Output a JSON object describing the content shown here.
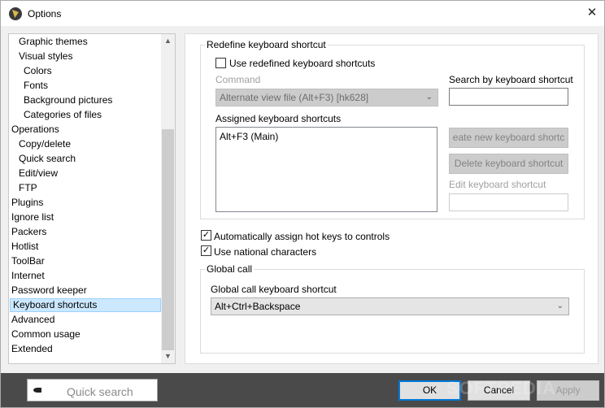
{
  "window": {
    "title": "Options",
    "close_glyph": "✕"
  },
  "tree": {
    "items": [
      {
        "label": "Graphic themes",
        "level": 1
      },
      {
        "label": "Visual styles",
        "level": 1
      },
      {
        "label": "Colors",
        "level": 2
      },
      {
        "label": "Fonts",
        "level": 2
      },
      {
        "label": "Background pictures",
        "level": 2
      },
      {
        "label": "Categories of files",
        "level": 2
      },
      {
        "label": "Operations",
        "level": 0
      },
      {
        "label": "Copy/delete",
        "level": 1
      },
      {
        "label": "Quick search",
        "level": 1
      },
      {
        "label": "Edit/view",
        "level": 1
      },
      {
        "label": "FTP",
        "level": 1
      },
      {
        "label": "Plugins",
        "level": 0
      },
      {
        "label": "Ignore list",
        "level": 0
      },
      {
        "label": "Packers",
        "level": 0
      },
      {
        "label": "Hotlist",
        "level": 0
      },
      {
        "label": "ToolBar",
        "level": 0
      },
      {
        "label": "Internet",
        "level": 0
      },
      {
        "label": "Password keeper",
        "level": 0
      },
      {
        "label": "Keyboard shortcuts",
        "level": 0,
        "selected": true
      },
      {
        "label": "Advanced",
        "level": 0
      },
      {
        "label": "Common usage",
        "level": 0
      },
      {
        "label": "Extended",
        "level": 0
      }
    ],
    "scroll_up_glyph": "▲",
    "scroll_down_glyph": "▼"
  },
  "redefine": {
    "group_title": "Redefine keyboard shortcut",
    "use_redefined_label": "Use redefined keyboard shortcuts",
    "use_redefined_checked": false,
    "command_label": "Command",
    "command_value": "Alternate view file (Alt+F3) [hk628]",
    "search_label": "Search by keyboard shortcut",
    "search_value": "",
    "assigned_label": "Assigned keyboard shortcuts",
    "assigned_items": [
      "Alt+F3 (Main)"
    ],
    "create_button": "eate new keyboard shortc",
    "delete_button": "Delete keyboard shortcut",
    "edit_label": "Edit keyboard shortcut",
    "edit_value": ""
  },
  "options": {
    "auto_assign_label": "Automatically assign hot keys to controls",
    "auto_assign_checked": true,
    "national_chars_label": "Use national characters",
    "national_chars_checked": true
  },
  "global_call": {
    "group_title": "Global call",
    "shortcut_label": "Global call keyboard shortcut",
    "shortcut_value": "Alt+Ctrl+Backspace"
  },
  "footer": {
    "quick_search_placeholder": "Quick search",
    "ok_label": "OK",
    "cancel_label": "Cancel",
    "apply_label": "Apply",
    "watermark": "SOFTPEDIA"
  },
  "colors": {
    "selection_bg": "#cce8ff",
    "accent": "#0078d7",
    "footer_bg": "#4a4a4a"
  }
}
